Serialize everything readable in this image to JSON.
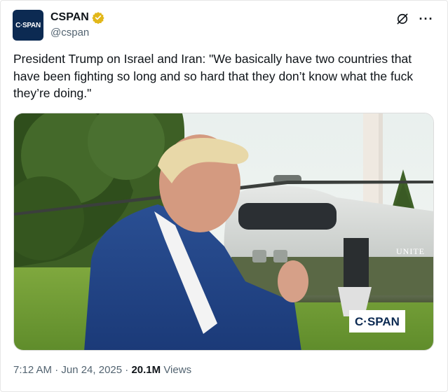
{
  "post": {
    "account": {
      "avatar_text": "C·SPAN",
      "name": "CSPAN",
      "handle": "@cspan",
      "verified_badge": "gold-check-icon"
    },
    "text": "President Trump on Israel and Iran: \"We basically have two countries that have been fighting so long and so hard that they don’t know what the fuck they’re doing.\"",
    "media": {
      "watermark": "C·SPAN",
      "helicopter_text": "UNITE"
    },
    "timestamp": "7:12 AM · Jun 24, 2025",
    "separator": " · ",
    "views_count": "20.1M",
    "views_label": " Views"
  },
  "colors": {
    "gold_badge": "#e2b719",
    "muted_text": "#536471",
    "cspan_navy": "#0c2a52"
  }
}
